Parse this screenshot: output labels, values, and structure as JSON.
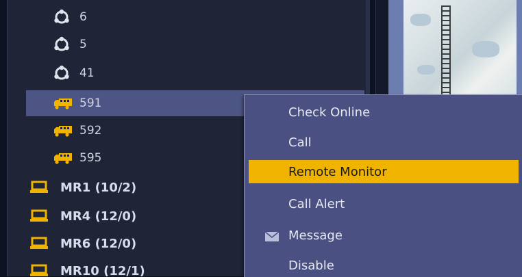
{
  "tree": {
    "rows": [
      {
        "label": "6",
        "icon": "users-circle-icon"
      },
      {
        "label": "5",
        "icon": "users-circle-icon"
      },
      {
        "label": "41",
        "icon": "users-circle-icon"
      },
      {
        "label": "591",
        "icon": "truck-icon",
        "selected": true
      },
      {
        "label": "592",
        "icon": "truck-icon"
      },
      {
        "label": "595",
        "icon": "truck-icon"
      }
    ],
    "groups": [
      {
        "label": "MR1 (10/2)",
        "icon": "radio-device-icon"
      },
      {
        "label": "MR4 (12/0)",
        "icon": "radio-device-icon"
      },
      {
        "label": "MR6 (12/0)",
        "icon": "radio-device-icon"
      },
      {
        "label": "MR10 (12/1)",
        "icon": "radio-device-icon"
      }
    ]
  },
  "context_menu": {
    "items": [
      {
        "label": "Check Online"
      },
      {
        "label": "Call"
      },
      {
        "label": "Remote Monitor",
        "highlighted": true
      },
      {
        "label": "Call Alert"
      },
      {
        "label": "Message",
        "icon": "envelope-icon"
      },
      {
        "label": "Disable"
      }
    ]
  },
  "colors": {
    "highlight": "#f0b400",
    "menu_bg": "#4a5081",
    "tree_bg": "#1f2436",
    "selected_row": "#4c5583",
    "icon_yellow": "#f0b400"
  }
}
